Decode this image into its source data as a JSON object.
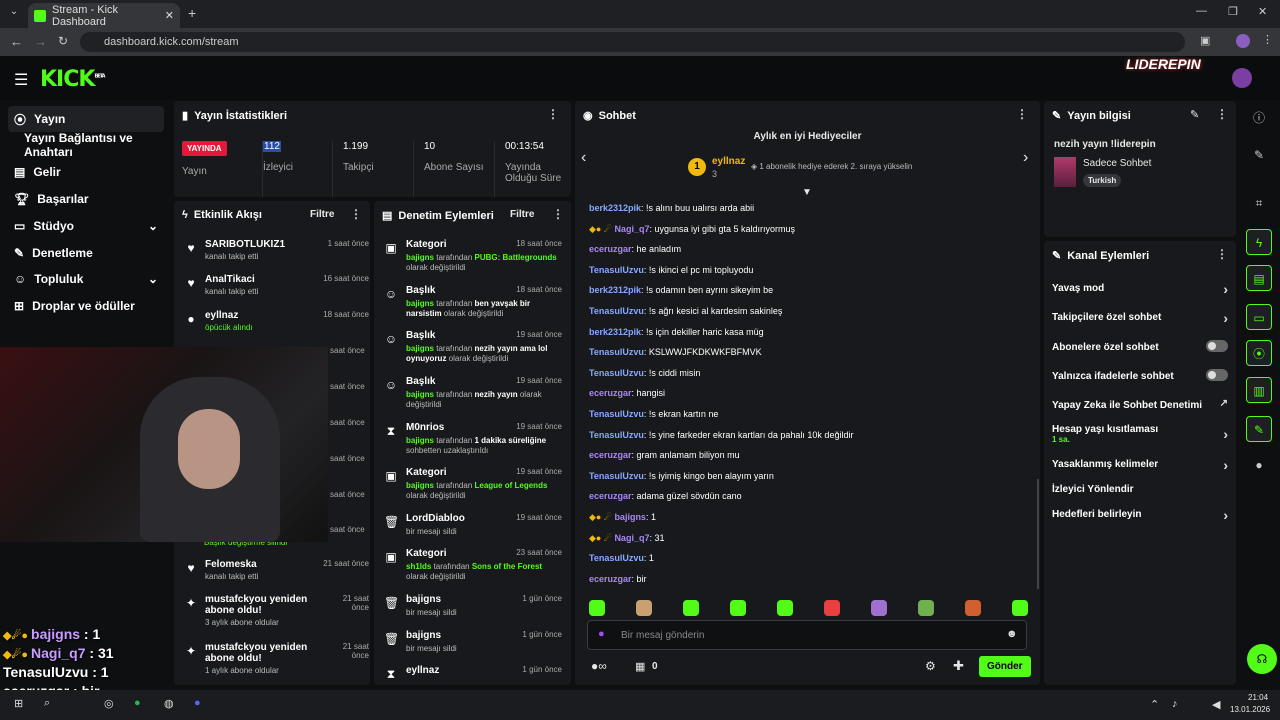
{
  "browser": {
    "tab_title": "Stream - Kick Dashboard",
    "url": "dashboard.kick.com/stream"
  },
  "header": {
    "logo": "KICK",
    "logo_sup": "BETA",
    "brand_overlay": "LIDEREPIN"
  },
  "sidebar": {
    "items": [
      {
        "label": "Yayın"
      },
      {
        "label": "Yayın Bağlantısı ve Anahtarı"
      },
      {
        "label": "Gelir"
      },
      {
        "label": "Başarılar"
      },
      {
        "label": "Stüdyo"
      },
      {
        "label": "Denetleme"
      },
      {
        "label": "Topluluk"
      },
      {
        "label": "Droplar ve ödüller"
      }
    ]
  },
  "stats": {
    "title": "Yayın İstatistikleri",
    "live_badge": "YAYINDA",
    "live_label": "Yayın",
    "viewers": "112",
    "viewers_label": "İzleyici",
    "followers": "1.199",
    "followers_label": "Takipçi",
    "subs": "10",
    "subs_label": "Abone Sayısı",
    "duration": "00:13:54",
    "duration_label": "Yayında Olduğu Süre"
  },
  "activity": {
    "title": "Etkinlik Akışı",
    "filter": "Filtre",
    "items": [
      {
        "t": "SARIBOTLUKIZ1",
        "s": "kanalı takip etti",
        "time": "1 saat önce"
      },
      {
        "t": "AnalTikaci",
        "s": "kanalı takip etti",
        "time": "16 saat önce"
      },
      {
        "t": "eyllnaz",
        "s": "öpücük alındı",
        "time": "18 saat önce"
      },
      {
        "t": "",
        "s": "",
        "time": "saat önce"
      },
      {
        "t": "",
        "s": "",
        "time": "saat önce"
      },
      {
        "t": "",
        "s": "",
        "time": "saat önce"
      },
      {
        "t": "",
        "s": "",
        "time": "saat önce"
      },
      {
        "t": "",
        "s": "",
        "time": "saat önce"
      },
      {
        "t": "",
        "s": "",
        "time": "saat önce"
      },
      {
        "t": "",
        "s": "Başlık değiştirme silindi",
        "time": ""
      },
      {
        "t": "Felomeska",
        "s": "kanalı takip etti",
        "time": "21 saat önce"
      },
      {
        "t": "mustafckyou yeniden abone oldu!",
        "s": "3 aylık abone oldular",
        "time": "21 saat önce"
      },
      {
        "t": "mustafckyou yeniden abone oldu!",
        "s": "1 aylık abone oldular",
        "time": "21 saat önce"
      }
    ]
  },
  "moderation": {
    "title": "Denetim Eylemleri",
    "filter": "Filtre",
    "items": [
      {
        "t": "Kategori",
        "who": "bajigns",
        "s": " tarafından ",
        "hl": "PUBG: Battlegrounds",
        "e": " olarak değiştirildi",
        "time": "18 saat önce"
      },
      {
        "t": "Başlık",
        "who": "bajigns",
        "s": " tarafından ",
        "hl": "ben yavşak bir narsistim",
        "e": " olarak değiştirildi",
        "time": "18 saat önce"
      },
      {
        "t": "Başlık",
        "who": "bajigns",
        "s": " tarafından ",
        "hl": "nezih yayın ama lol oynuyoruz",
        "e": " olarak değiştirildi",
        "time": "19 saat önce"
      },
      {
        "t": "Başlık",
        "who": "bajigns",
        "s": " tarafından ",
        "hl": "nezih yayın",
        "e": " olarak değiştirildi",
        "time": "19 saat önce"
      },
      {
        "t": "M0nrios",
        "who": "bajigns",
        "s": " tarafından ",
        "hl": "1 dakika süreliğine",
        "e": " sohbetten uzaklaştırıldı",
        "time": "19 saat önce"
      },
      {
        "t": "Kategori",
        "who": "bajigns",
        "s": " tarafından ",
        "hl": "League of Legends",
        "e": " olarak değiştirildi",
        "time": "19 saat önce"
      },
      {
        "t": "LordDiabloo",
        "who": "",
        "s": "bir mesajı sildi",
        "hl": "",
        "e": "",
        "time": "19 saat önce"
      },
      {
        "t": "Kategori",
        "who": "sh1lds",
        "s": " tarafından ",
        "hl": "Sons of the Forest",
        "e": " olarak değiştirildi",
        "time": "23 saat önce"
      },
      {
        "t": "bajigns",
        "who": "",
        "s": "bir mesajı sildi",
        "hl": "",
        "e": "",
        "time": "1 gün önce"
      },
      {
        "t": "bajigns",
        "who": "",
        "s": "bir mesajı sildi",
        "hl": "",
        "e": "",
        "time": "1 gün önce"
      },
      {
        "t": "eyllnaz",
        "who": "",
        "s": "",
        "hl": "",
        "e": "",
        "time": "1 gün önce"
      }
    ]
  },
  "chat": {
    "title": "Sohbet",
    "gifters_title": "Aylık en iyi Hediyeciler",
    "top_gifter": "eyllnaz",
    "top_gifter_count": "3",
    "gifter_hint": "1 abonelik hediye ederek 2. sıraya yükselin",
    "placeholder": "Bir mesaj gönderin",
    "send": "Gönder",
    "count": "0",
    "messages": [
      {
        "u": "berk2312pik",
        "m": ": !s alını buu ualırsı arda abii",
        "c": "u-blue"
      },
      {
        "u": "Nagi_q7",
        "m": ": uygunsa iyi gibi gta 5 kaldırıyormuş",
        "c": "u-purple"
      },
      {
        "u": "eceruzgar",
        "m": ": he anladım",
        "c": "u-purple"
      },
      {
        "u": "TenasulUzvu",
        "m": ": !s ikinci el pc mi topluyodu",
        "c": "u-blue"
      },
      {
        "u": "berk2312pik",
        "m": ": !s odamın ben ayrını sikeyim be",
        "c": "u-blue"
      },
      {
        "u": "TenasulUzvu",
        "m": ": !s ağrı kesici al kardesim sakinleş",
        "c": "u-blue"
      },
      {
        "u": "berk2312pik",
        "m": ": !s için dekiller haric kasa müg",
        "c": "u-blue"
      },
      {
        "u": "TenasulUzvu",
        "m": ": KSLWWJFKDKWKFBFMVK",
        "c": "u-blue"
      },
      {
        "u": "TenasulUzvu",
        "m": ": !s ciddi misin",
        "c": "u-blue"
      },
      {
        "u": "eceruzgar",
        "m": ": hangisi",
        "c": "u-purple"
      },
      {
        "u": "TenasulUzvu",
        "m": ": !s ekran kartın ne",
        "c": "u-blue"
      },
      {
        "u": "TenasulUzvu",
        "m": ": !s yine farkeder ekran kartları da pahalı 10k değildir",
        "c": "u-blue"
      },
      {
        "u": "eceruzgar",
        "m": ": gram anlamam biliyon mu",
        "c": "u-purple"
      },
      {
        "u": "TenasulUzvu",
        "m": ": !s iyimiş kingo ben alayım yarın",
        "c": "u-blue"
      },
      {
        "u": "eceruzgar",
        "m": ": adama güzel sövdün cano",
        "c": "u-purple"
      },
      {
        "u": "bajigns",
        "m": ": 1",
        "c": "u-purple"
      },
      {
        "u": "Nagi_q7",
        "m": ": 31",
        "c": "u-purple"
      },
      {
        "u": "TenasulUzvu",
        "m": ": 1",
        "c": "u-blue"
      },
      {
        "u": "eceruzgar",
        "m": ": bir",
        "c": "u-purple"
      }
    ]
  },
  "stream_info": {
    "title": "Yayın bilgisi",
    "stream_title": "nezih yayın !liderepin",
    "category": "Sadece Sohbet",
    "tag": "Turkish"
  },
  "channel_actions": {
    "title": "Kanal Eylemleri",
    "items": [
      {
        "label": "Yavaş mod",
        "sub": ""
      },
      {
        "label": "Takipçilere özel sohbet",
        "sub": ""
      },
      {
        "label": "Abonelere özel sohbet",
        "sub": ""
      },
      {
        "label": "Yalnızca ifadelerle sohbet",
        "sub": ""
      },
      {
        "label": "Yapay Zeka ile Sohbet Denetimi",
        "sub": ""
      },
      {
        "label": "Hesap yaşı kısıtlaması",
        "sub": "1 sa."
      },
      {
        "label": "Yasaklanmış kelimeler",
        "sub": ""
      },
      {
        "label": "İzleyici Yönlendir",
        "sub": ""
      },
      {
        "label": "Hedefleri belirleyin",
        "sub": ""
      }
    ]
  },
  "overlay": {
    "lines": [
      {
        "u": "bajigns",
        "m": " : 1"
      },
      {
        "u": "Nagi_q7",
        "m": " : 31"
      },
      {
        "u": "TenasulUzvu",
        "m": " : 1"
      },
      {
        "u": "eceruzgar",
        "m": " : bir"
      }
    ]
  },
  "taskbar": {
    "time": "21:04",
    "date": "13.01.2026"
  },
  "colors": {
    "accent": "#53fc18",
    "live": "#e3193b",
    "panel": "#18191c"
  }
}
